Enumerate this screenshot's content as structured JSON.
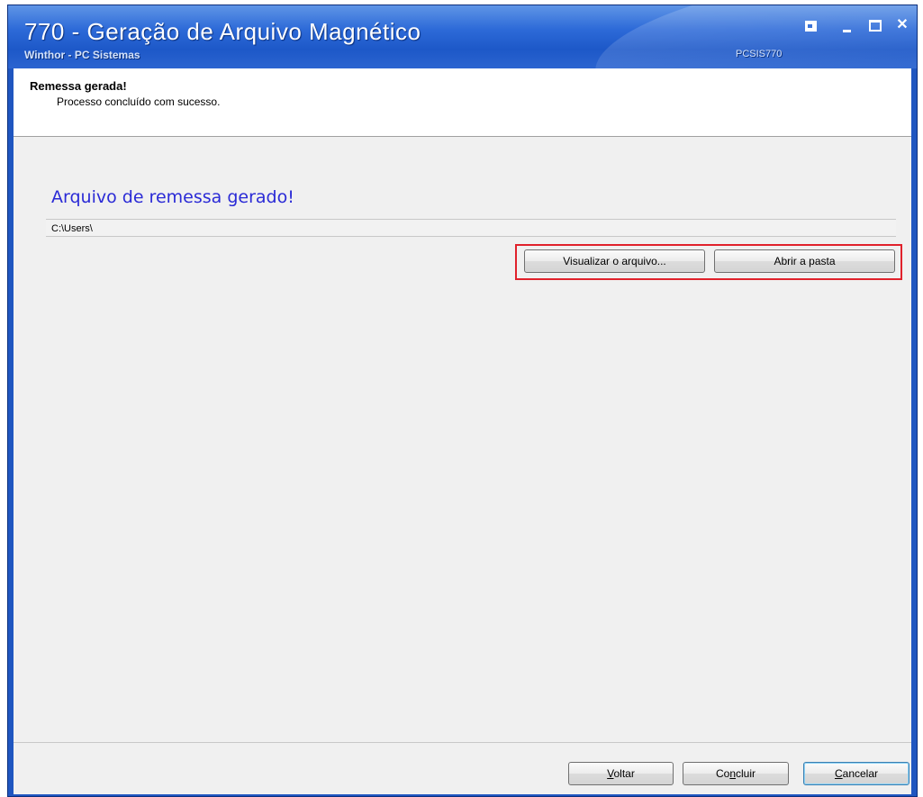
{
  "window": {
    "title": "770 - Geração de Arquivo Magnético",
    "subtitle": "Winthor - PC Sistemas",
    "code": "PCSIS770"
  },
  "header": {
    "title": "Remessa gerada!",
    "description": "Processo concluído com sucesso."
  },
  "main": {
    "heading": "Arquivo de remessa gerado!",
    "file_path": "C:\\Users\\",
    "view_file_label": "Visualizar o arquivo...",
    "open_folder_label": "Abrir a pasta"
  },
  "footer": {
    "back_label": {
      "accel": "V",
      "rest": "oltar"
    },
    "finish_label": {
      "pre": "Co",
      "accel": "n",
      "rest": "cluir"
    },
    "cancel_label": {
      "accel": "C",
      "rest": "ancelar"
    }
  },
  "colors": {
    "heading": "#2a2ad6",
    "highlight": "#e0212b",
    "titlebar": "#1d58c8"
  }
}
